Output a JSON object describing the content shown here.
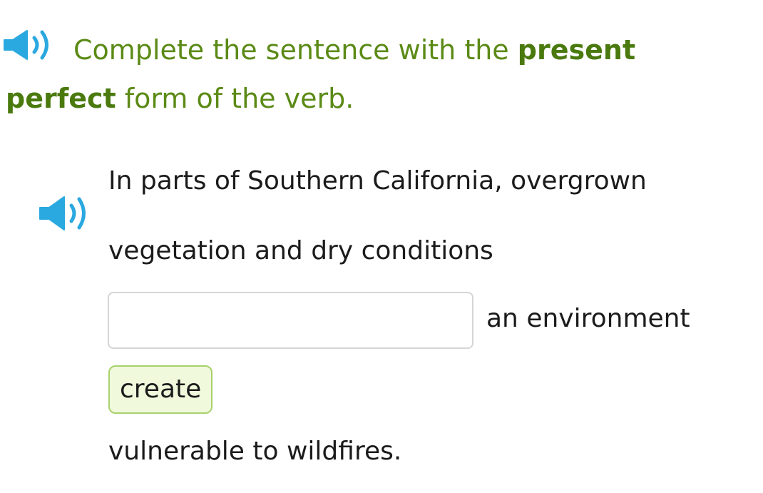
{
  "instruction": {
    "prefix": "Complete the sentence with the ",
    "bold": "present perfect",
    "suffix": " form of the verb."
  },
  "question": {
    "line1": "In parts of Southern California, overgrown",
    "line2": "vegetation and dry conditions",
    "after_blank": "an environment",
    "verb_hint": "create",
    "line4": "vulnerable to wildfires.",
    "answer_value": ""
  },
  "icons": {
    "instruction_audio": "speaker-icon",
    "question_audio": "speaker-icon"
  },
  "colors": {
    "speaker": "#2aa8e0",
    "instruction_text": "#5b8a16",
    "hint_border": "#a7d16b",
    "hint_fill": "#f1f9dc",
    "box_border": "#d5d5d5"
  }
}
